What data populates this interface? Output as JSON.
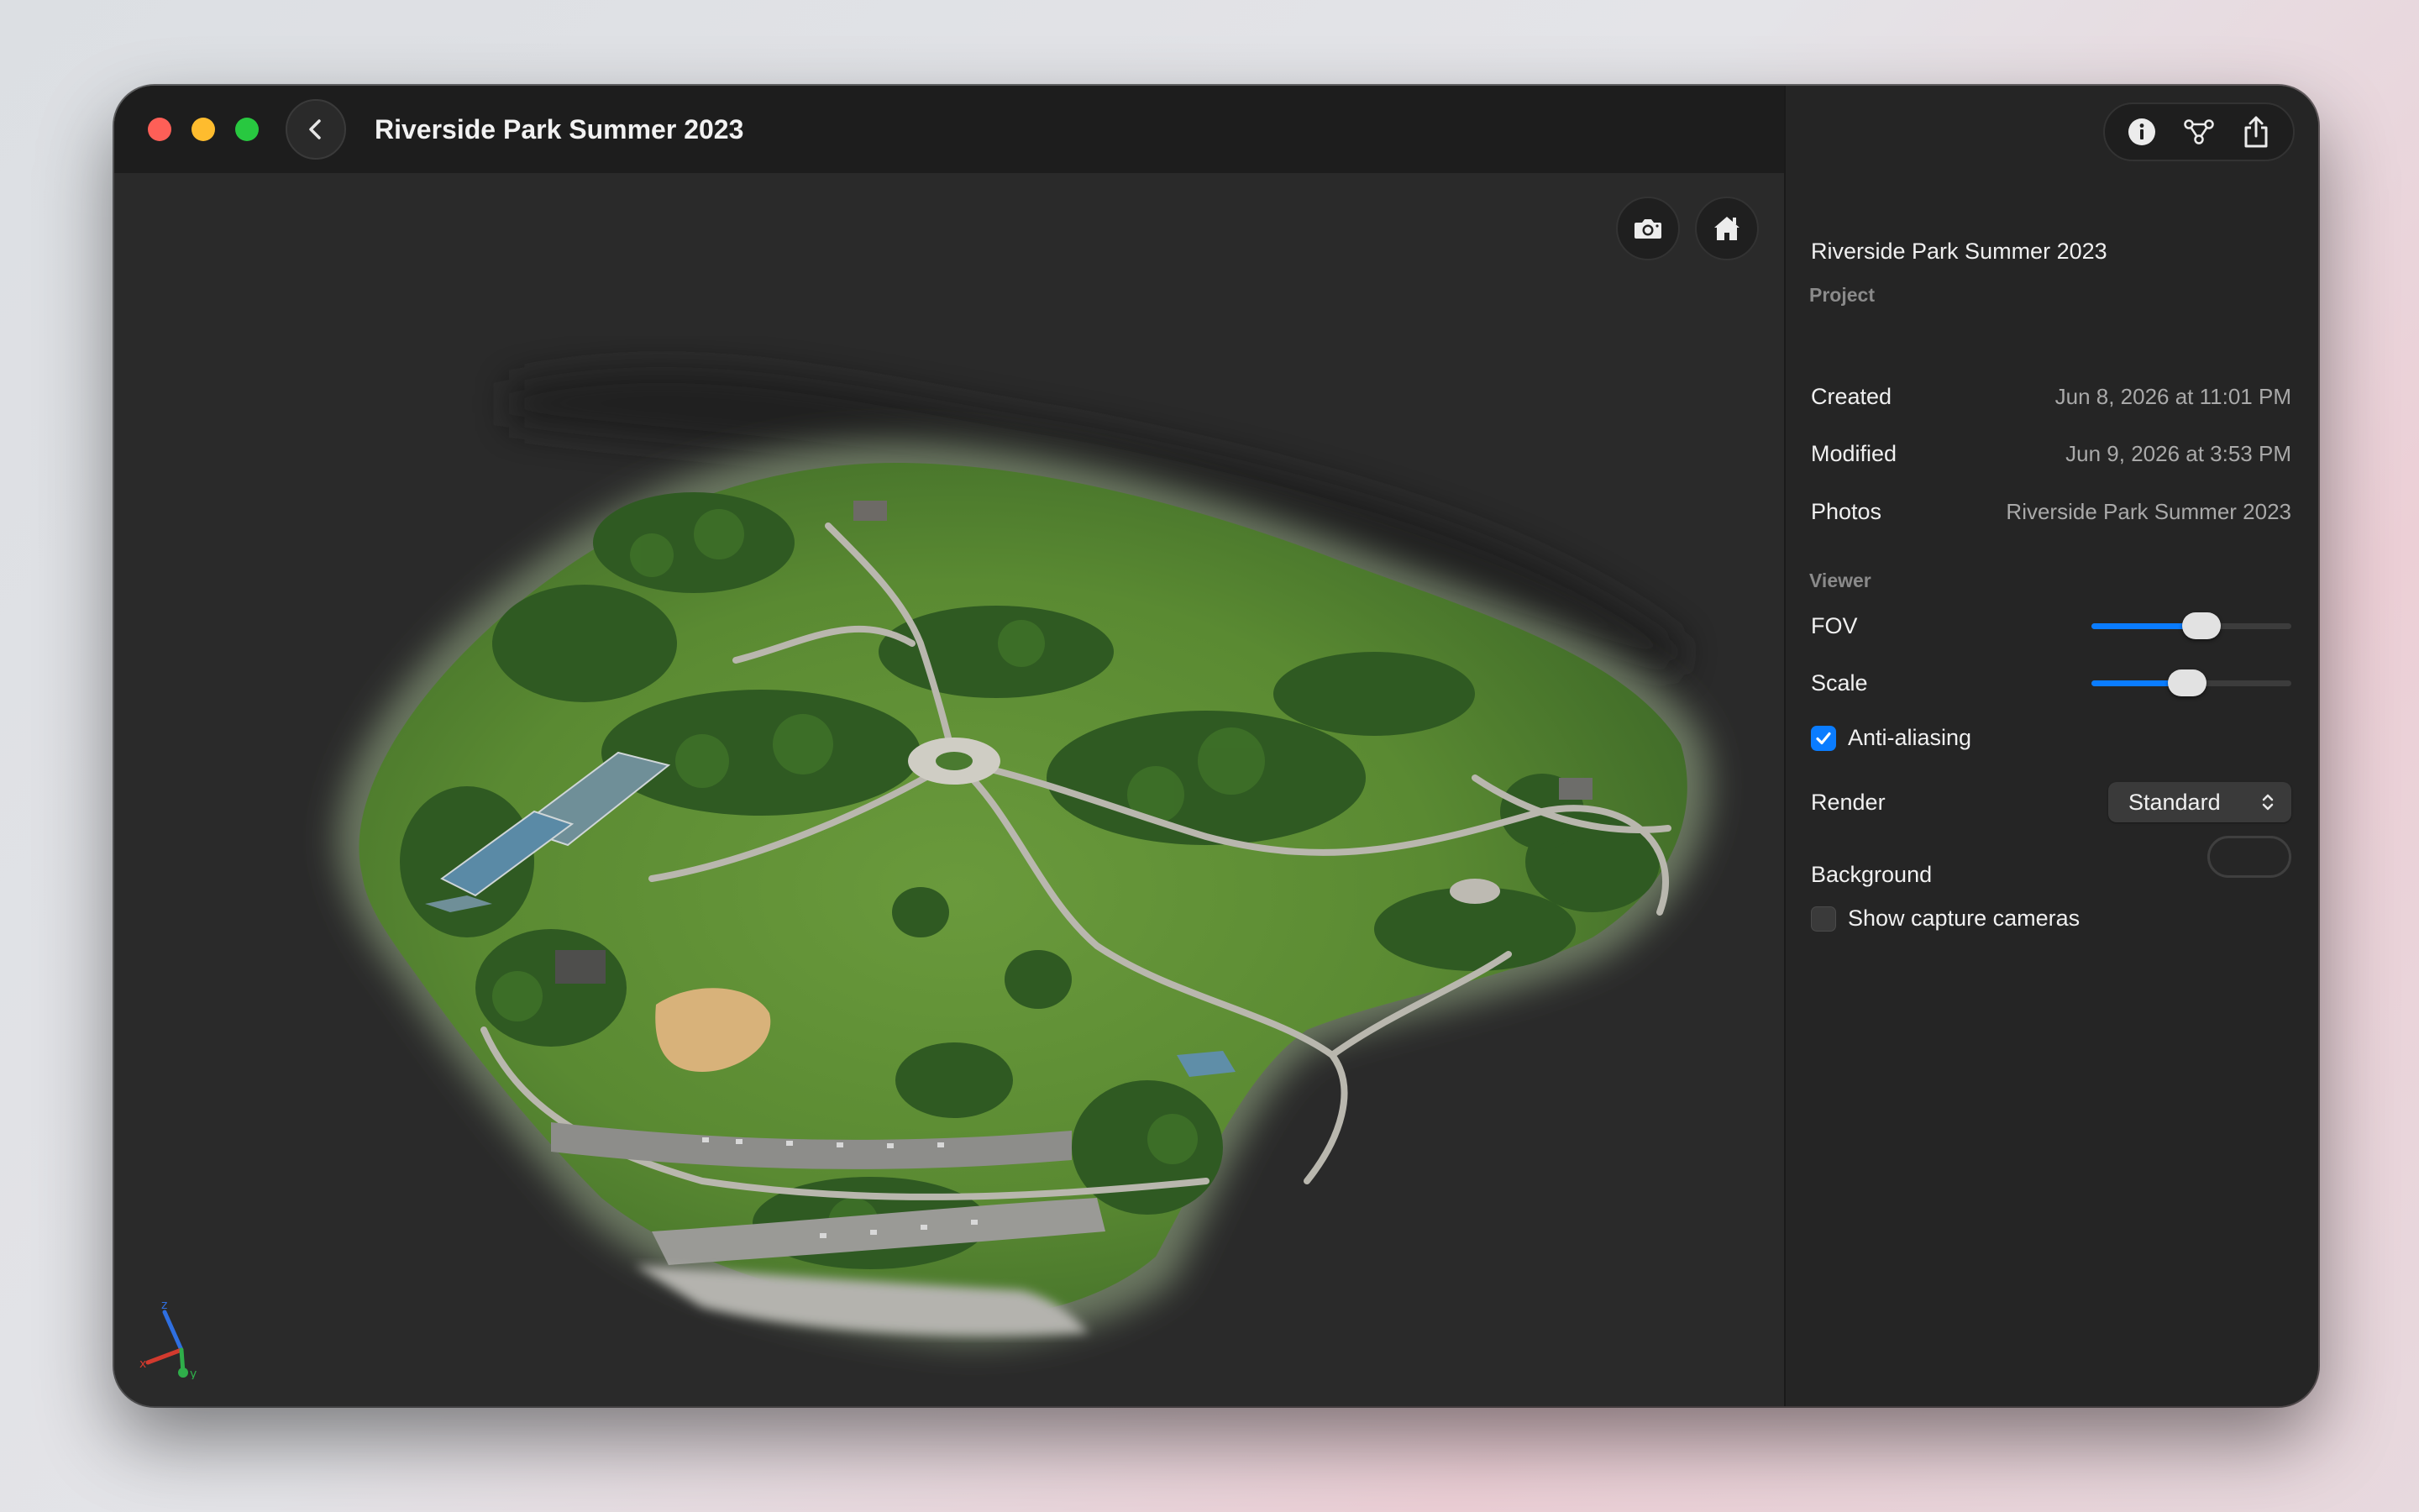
{
  "window": {
    "title": "Riverside Park Summer 2023"
  },
  "viewer_toolbar": {
    "snapshot_icon": "camera-icon",
    "home_icon": "home-icon"
  },
  "sidebar": {
    "toolbar": {
      "info_icon": "info-icon",
      "graph_icon": "node-graph-icon",
      "share_icon": "share-icon"
    },
    "project": {
      "section_label": "Project",
      "name": "Riverside Park Summer 2023",
      "created_label": "Created",
      "created_value": "Jun 8, 2026 at 11:01 PM",
      "modified_label": "Modified",
      "modified_value": "Jun 9, 2026 at 3:53 PM",
      "photos_label": "Photos",
      "photos_value": "Riverside Park Summer 2023"
    },
    "viewer": {
      "section_label": "Viewer",
      "fov_label": "FOV",
      "fov_fraction": 0.55,
      "scale_label": "Scale",
      "scale_fraction": 0.48,
      "antialiasing_label": "Anti-aliasing",
      "antialiasing_checked": true,
      "render_label": "Render",
      "render_value": "Standard",
      "background_label": "Background",
      "background_color": "#262626",
      "show_cameras_label": "Show capture cameras",
      "show_cameras_checked": false
    }
  },
  "colors": {
    "accent": "#0a7cff",
    "close": "#fe5f57",
    "minimize": "#febc2e",
    "zoom": "#28c840"
  }
}
